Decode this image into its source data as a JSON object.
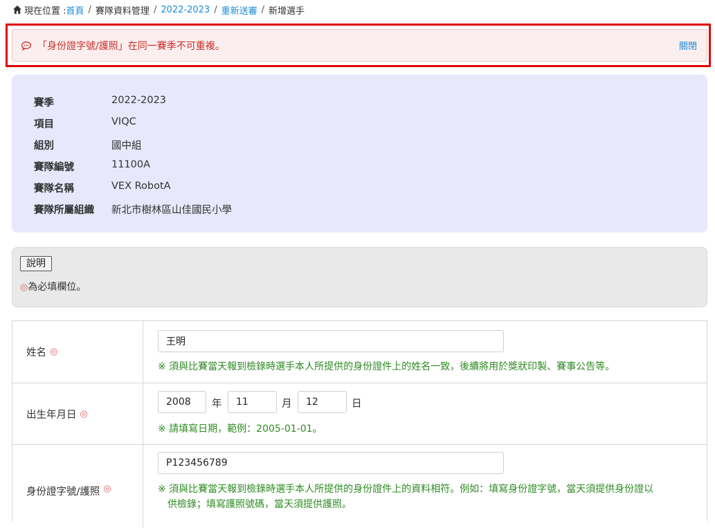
{
  "breadcrumb": {
    "prefix": "現在位置 :",
    "home": "首頁",
    "sep": "/",
    "section": "賽隊資料管理",
    "season_link": "2022-2023",
    "resubmit_link": "重新送審",
    "current": "新增選手"
  },
  "alert": {
    "message": "「身份證字號/護照」在同一賽季不可重複。",
    "close_label": "關閉"
  },
  "team_info": {
    "rows": [
      {
        "label": "賽季",
        "value": "2022-2023"
      },
      {
        "label": "項目",
        "value": "VIQC"
      },
      {
        "label": "組別",
        "value": "國中組"
      },
      {
        "label": "賽隊編號",
        "value": "11100A"
      },
      {
        "label": "賽隊名稱",
        "value": "VEX RobotA"
      },
      {
        "label": "賽隊所屬組織",
        "value": "新北市樹林區山佳國民小學"
      }
    ]
  },
  "notes": {
    "button_label": "說明",
    "required_mark": "◎",
    "required_text": "為必填欄位。"
  },
  "form": {
    "required_mark": "◎",
    "name": {
      "label": "姓名",
      "value": "王明",
      "hint": "※ 須與比賽當天報到檢錄時選手本人所提供的身份證件上的姓名一致，後續將用於獎狀印製、賽事公告等。"
    },
    "birthday": {
      "label": "出生年月日",
      "year": "2008",
      "year_unit": "年",
      "month": "11",
      "month_unit": "月",
      "day": "12",
      "day_unit": "日",
      "hint": "※ 請填寫日期，範例：2005-01-01。"
    },
    "id_number": {
      "label": "身份證字號/護照",
      "value": "P123456789",
      "hint_line1": "※ 須與比賽當天報到檢錄時選手本人所提供的身份證件上的資料相符。例如：填寫身份證字號，當天須提供身份證以",
      "hint_line2": "供檢錄；填寫護照號碼，當天須提供護照。"
    }
  }
}
